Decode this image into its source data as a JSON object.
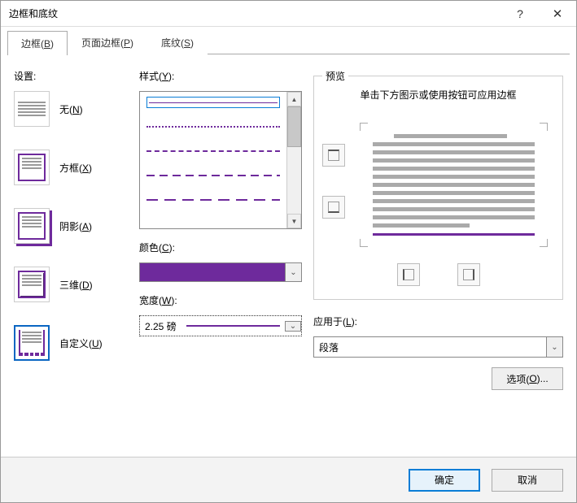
{
  "title": "边框和底纹",
  "titlebar": {
    "help": "?",
    "close": "✕"
  },
  "tabs": {
    "border_pre": "边框(",
    "border_u": "B",
    "border_post": ")",
    "page_pre": "页面边框(",
    "page_u": "P",
    "page_post": ")",
    "shade_pre": "底纹(",
    "shade_u": "S",
    "shade_post": ")"
  },
  "settings": {
    "label": "设置:",
    "none_pre": "无(",
    "none_u": "N",
    "none_post": ")",
    "box_pre": "方框(",
    "box_u": "X",
    "box_post": ")",
    "shadow_pre": "阴影(",
    "shadow_u": "A",
    "shadow_post": ")",
    "three_d_pre": "三维(",
    "three_d_u": "D",
    "three_d_post": ")",
    "custom_pre": "自定义(",
    "custom_u": "U",
    "custom_post": ")"
  },
  "style": {
    "label_pre": "样式(",
    "label_u": "Y",
    "label_post": "):"
  },
  "color": {
    "label_pre": "颜色(",
    "label_u": "C",
    "label_post": "):",
    "value": "#6e2a9c"
  },
  "width": {
    "label_pre": "宽度(",
    "label_u": "W",
    "label_post": "):",
    "value": "2.25 磅"
  },
  "preview": {
    "label": "预览",
    "hint": "单击下方图示或使用按钮可应用边框"
  },
  "apply": {
    "label_pre": "应用于(",
    "label_u": "L",
    "label_post": "):",
    "value": "段落"
  },
  "options": {
    "label_pre": "选项(",
    "label_u": "O",
    "label_post": ")..."
  },
  "footer": {
    "ok": "确定",
    "cancel": "取消"
  }
}
